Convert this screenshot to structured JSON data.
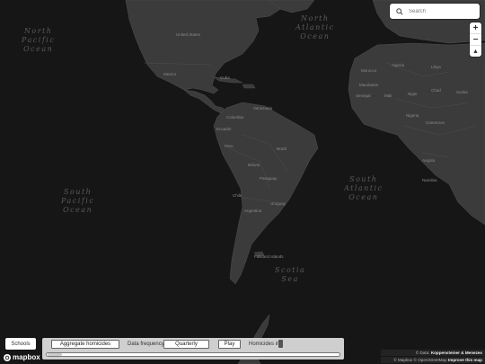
{
  "search": {
    "placeholder": "Search"
  },
  "zoom": {
    "in": "+",
    "out": "−",
    "compass": "▲"
  },
  "oceans": [
    {
      "key": "n-pacific",
      "lines": [
        "North",
        "Pacific",
        "Ocean"
      ]
    },
    {
      "key": "n-atlantic",
      "lines": [
        "North",
        "Atlantic",
        "Ocean"
      ]
    },
    {
      "key": "s-pacific",
      "lines": [
        "South",
        "Pacific",
        "Ocean"
      ]
    },
    {
      "key": "s-atlantic",
      "lines": [
        "South",
        "Atlantic",
        "Ocean"
      ]
    },
    {
      "key": "scotia",
      "lines": [
        "Scotia",
        "Sea"
      ]
    }
  ],
  "places": [
    "United States",
    "Mexico",
    "Cuba",
    "Colombia",
    "Venezuela",
    "Ecuador",
    "Peru",
    "Brazil",
    "Bolivia",
    "Paraguay",
    "Chile",
    "Argentina",
    "Uruguay",
    "Falkland Islands",
    "Morocco",
    "Algeria",
    "Mali",
    "Niger",
    "Nigeria",
    "Chad",
    "Sudan",
    "Cameroon",
    "Angola",
    "Namibia",
    "Mauritania",
    "Senegal",
    "Libya"
  ],
  "controls": {
    "schools_label": "Schools",
    "aggregate_label": "Aggregate homicides",
    "frequency_label": "Data frequency:",
    "frequency_value": "Quarterly",
    "play_label": "Play",
    "homicides_label": "Homicides in"
  },
  "slider": {
    "value": 0
  },
  "branding": {
    "logo": "mapbox"
  },
  "attribution": {
    "line1_prefix": "© Data: ",
    "line1_bold": "Koppensteiner & Menezes",
    "line2_prefix": "© Mapbox © OpenStreetMap ",
    "line2_bold": "Improve this map"
  },
  "colors": {
    "ocean": "#161616",
    "land": "#3a3a3a",
    "border": "#4d4d4d",
    "panel": "#cfcfcf"
  }
}
